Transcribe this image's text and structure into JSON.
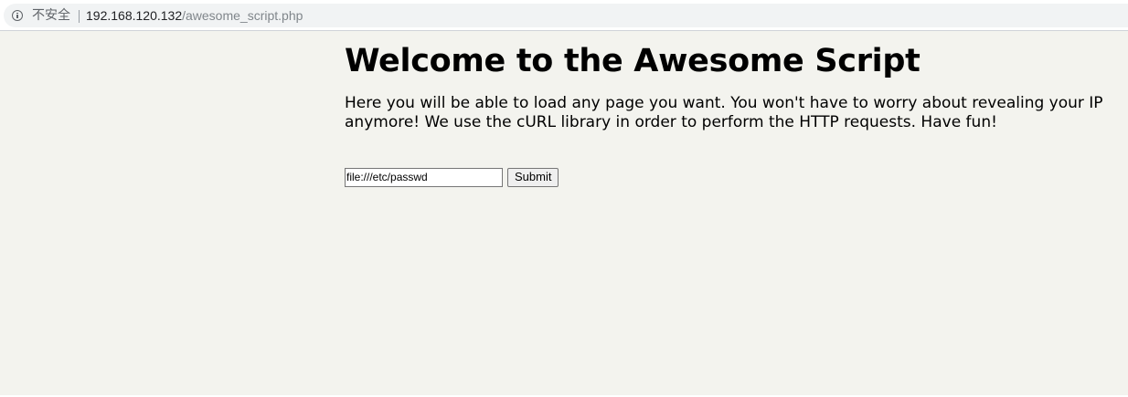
{
  "browser": {
    "security_label": "不安全",
    "url_host": "192.168.120.132",
    "url_path": "/awesome_script.php"
  },
  "page": {
    "title": "Welcome to the Awesome Script",
    "description": "Here you will be able to load any page you want. You won't have to worry about revealing your IP anymore! We use the cURL library in order to perform the HTTP requests. Have fun!",
    "form": {
      "input_value": "file:///etc/passwd",
      "submit_label": "Submit"
    }
  },
  "colors": {
    "page_background": "#f3f3ee",
    "omnibox_background": "#f1f3f4"
  }
}
